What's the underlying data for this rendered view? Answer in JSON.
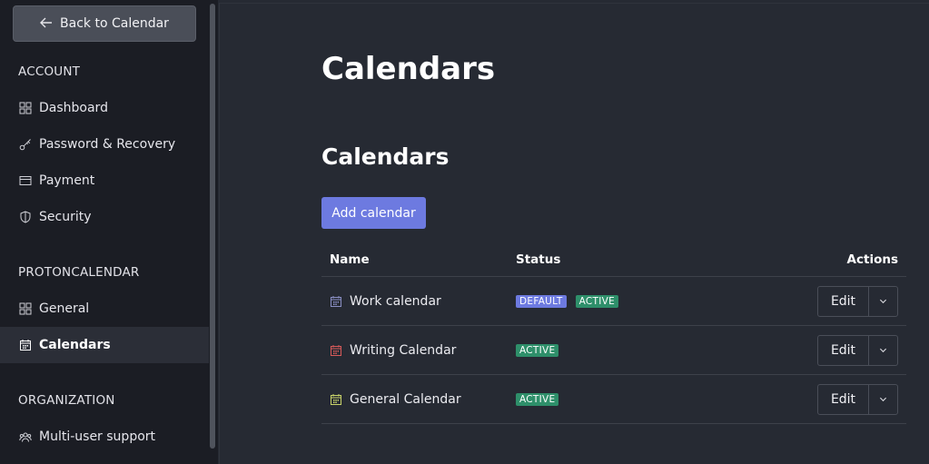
{
  "sidebar": {
    "back_label": "Back to Calendar",
    "sections": [
      {
        "title": "ACCOUNT"
      },
      {
        "title": "PROTONCALENDAR"
      },
      {
        "title": "ORGANIZATION"
      }
    ],
    "items": [
      {
        "label": "Dashboard",
        "icon": "grid-icon"
      },
      {
        "label": "Password & Recovery",
        "icon": "key-icon"
      },
      {
        "label": "Payment",
        "icon": "credit-card-icon"
      },
      {
        "label": "Security",
        "icon": "shield-icon"
      },
      {
        "label": "General",
        "icon": "grid-icon"
      },
      {
        "label": "Calendars",
        "icon": "calendar-icon",
        "active": true
      },
      {
        "label": "Multi-user support",
        "icon": "users-icon"
      }
    ]
  },
  "main": {
    "page_title": "Calendars",
    "section_heading": "Calendars",
    "add_button_label": "Add calendar",
    "table": {
      "columns": [
        "Name",
        "Status",
        "Actions"
      ],
      "rows": [
        {
          "name": "Work calendar",
          "color": "#8a8fc4",
          "badges": [
            "DEFAULT",
            "ACTIVE"
          ],
          "action": "Edit"
        },
        {
          "name": "Writing Calendar",
          "color": "#d85a5a",
          "badges": [
            "ACTIVE"
          ],
          "action": "Edit"
        },
        {
          "name": "General Calendar",
          "color": "#c9d36a",
          "badges": [
            "ACTIVE"
          ],
          "action": "Edit"
        }
      ]
    }
  },
  "colors": {
    "accent": "#6d7ae0",
    "active_badge": "#2e8f6a",
    "sidebar_bg": "#1b1d24",
    "main_bg": "#262a33"
  }
}
